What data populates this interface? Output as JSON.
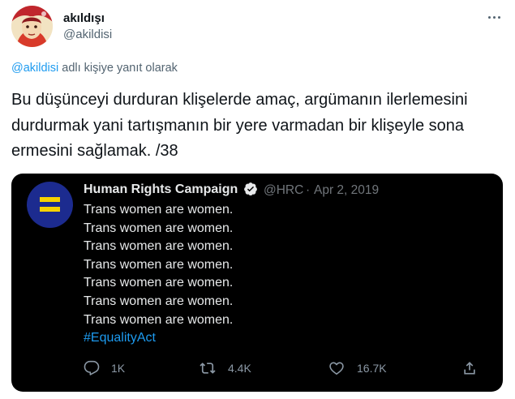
{
  "tweet": {
    "author_name": "akıldışı",
    "author_handle": "@akildisi",
    "reply_to_link": "@akildisi",
    "reply_to_suffix": " adlı kişiye yanıt olarak",
    "text": "Bu düşünceyi durduran klişelerde amaç, argümanın ilerlemesini durdurmak yani tartışmanın bir yere varmadan bir klişeyle sona ermesini sağlamak. /38"
  },
  "quoted_tweet": {
    "name": "Human Rights Campaign",
    "handle": "@HRC",
    "separator": "·",
    "date": "Apr 2, 2019",
    "lines": [
      "Trans women are women.",
      "Trans women are women.",
      "Trans women are women.",
      "Trans women are women.",
      "Trans women are women.",
      "Trans women are women.",
      "Trans women are women."
    ],
    "hashtag": "#EqualityAct",
    "actions": {
      "replies": "1K",
      "retweets": "4.4K",
      "likes": "16.7K"
    }
  },
  "icons": [
    "avatar",
    "more-icon",
    "verified-badge-icon",
    "hrc-equal-logo",
    "reply-icon",
    "retweet-icon",
    "like-icon",
    "share-icon"
  ],
  "colors": {
    "link_blue": "#1d9bf0",
    "secondary_text": "#536471",
    "quote_background": "#000000",
    "hrc_blue": "#1c2b8f",
    "hrc_yellow": "#f6d300"
  }
}
